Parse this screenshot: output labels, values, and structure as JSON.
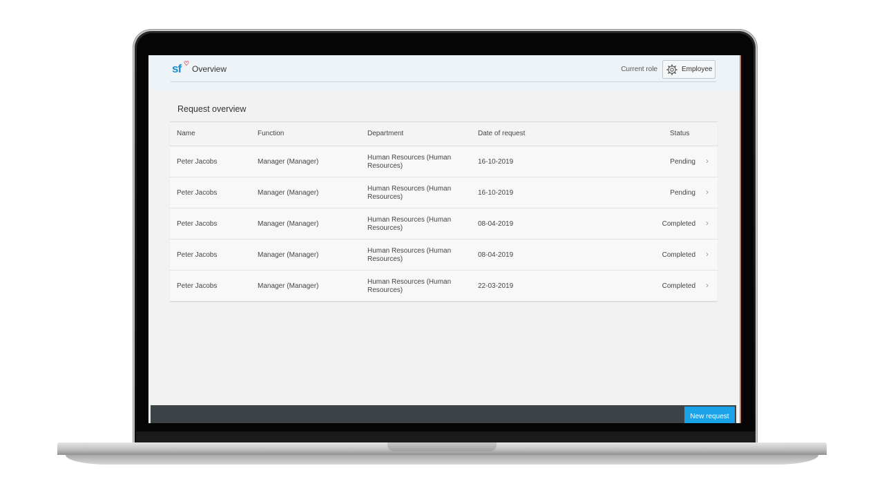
{
  "header": {
    "page_title": "Overview",
    "role_label": "Current role",
    "role_value": "Employee"
  },
  "main": {
    "section_title": "Request overview",
    "columns": {
      "name": "Name",
      "function": "Function",
      "department": "Department",
      "date": "Date of request",
      "status": "Status"
    },
    "rows": [
      {
        "name": "Peter Jacobs",
        "function": "Manager (Manager)",
        "department": "Human Resources (Human Resources)",
        "date": "16-10-2019",
        "status": "Pending"
      },
      {
        "name": "Peter Jacobs",
        "function": "Manager (Manager)",
        "department": "Human Resources (Human Resources)",
        "date": "16-10-2019",
        "status": "Pending"
      },
      {
        "name": "Peter Jacobs",
        "function": "Manager (Manager)",
        "department": "Human Resources (Human Resources)",
        "date": "08-04-2019",
        "status": "Completed"
      },
      {
        "name": "Peter Jacobs",
        "function": "Manager (Manager)",
        "department": "Human Resources (Human Resources)",
        "date": "08-04-2019",
        "status": "Completed"
      },
      {
        "name": "Peter Jacobs",
        "function": "Manager (Manager)",
        "department": "Human Resources (Human Resources)",
        "date": "22-03-2019",
        "status": "Completed"
      }
    ]
  },
  "footer": {
    "new_request_label": "New request"
  },
  "colors": {
    "accent": "#1aa3e8",
    "footer_bar": "#3c4347",
    "logo_blue": "#1a8fc9",
    "logo_heart": "#e02a3a"
  },
  "icons": [
    "heart-icon",
    "gear-icon",
    "chevron-right-icon"
  ]
}
